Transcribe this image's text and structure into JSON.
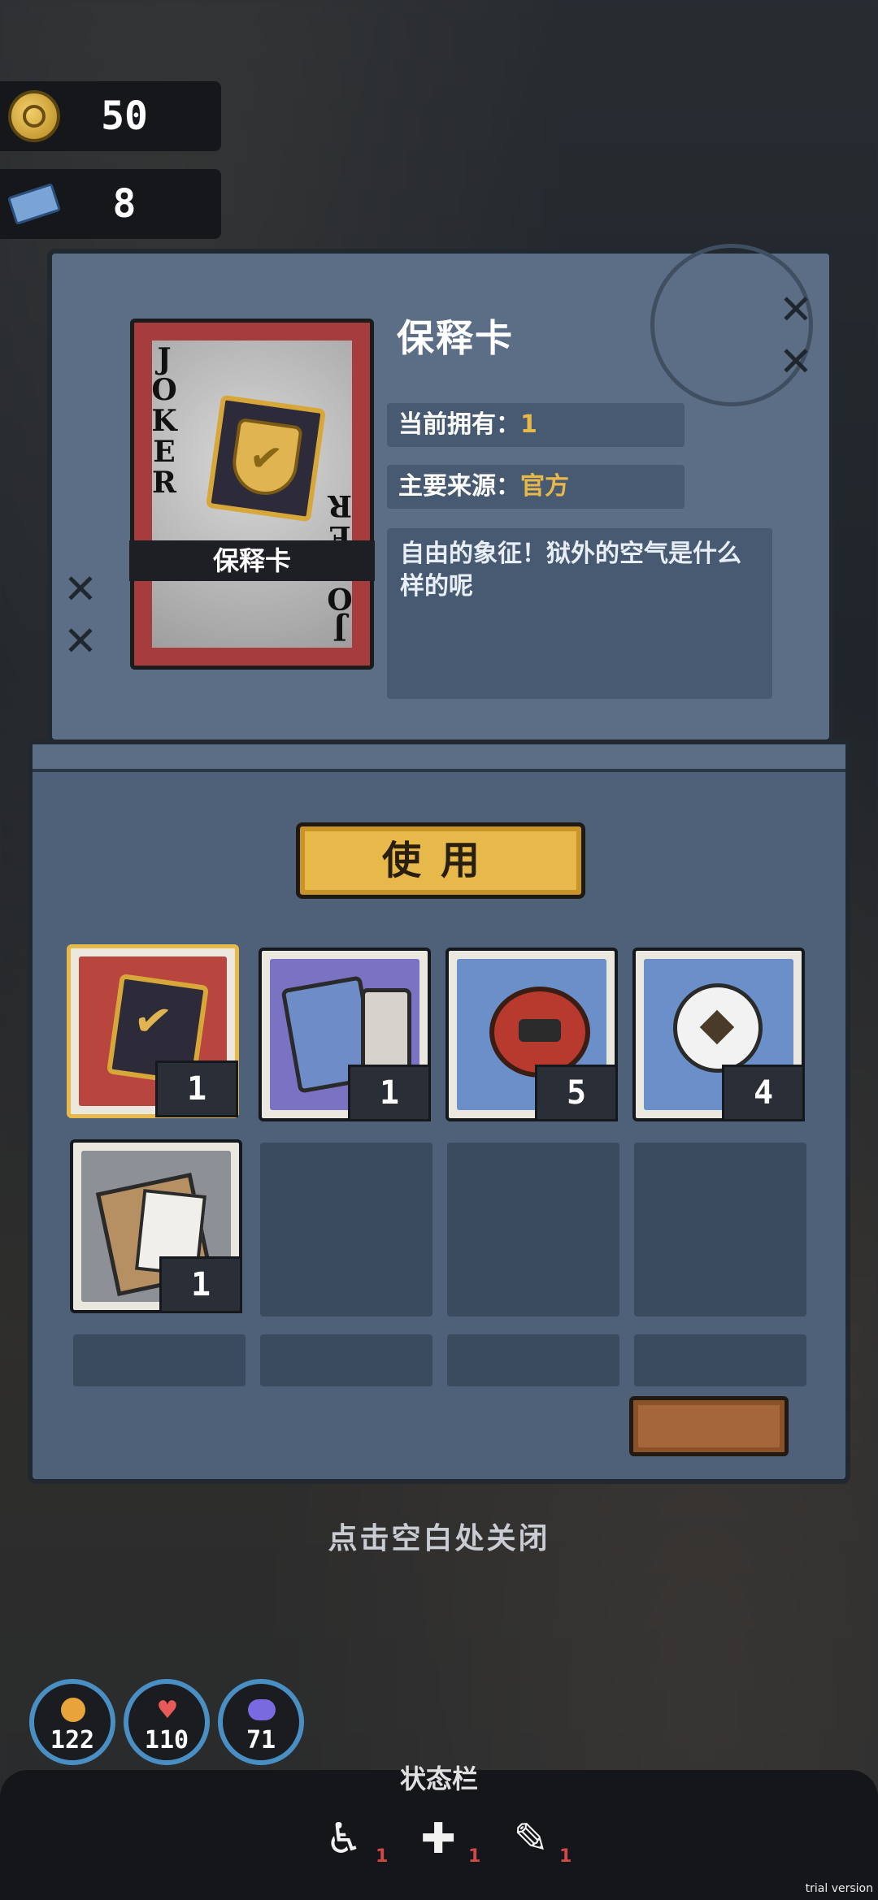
{
  "currency": {
    "coins": "50",
    "tickets": "8"
  },
  "item": {
    "title": "保释卡",
    "card_label": "保释卡",
    "card_corner_text": "JOKER",
    "owned_label": "当前拥有：",
    "owned_value": "1",
    "source_label": "主要来源：",
    "source_value": "官方",
    "description": "自由的象征！狱外的空气是什么样的呢"
  },
  "use_button": "使用",
  "inventory": [
    {
      "name": "bail-card",
      "icon": "shield-card-icon",
      "count": "1",
      "bg": "#b9453f",
      "selected": true
    },
    {
      "name": "map-pills",
      "icon": "map-pills-icon",
      "count": "1",
      "bg": "#7a72c2",
      "selected": false
    },
    {
      "name": "token",
      "icon": "token-icon",
      "count": "5",
      "bg": "#6a8fc9",
      "selected": false
    },
    {
      "name": "toilet-paper",
      "icon": "toilet-paper-icon",
      "count": "4",
      "bg": "#6a8fc9",
      "selected": false
    },
    {
      "name": "documents",
      "icon": "documents-icon",
      "count": "1",
      "bg": "#8e9097",
      "selected": false
    }
  ],
  "close_hint": "点击空白处关闭",
  "stats": [
    {
      "icon": "hunger-icon",
      "value": "122",
      "color": "#e8a43a"
    },
    {
      "icon": "heart-icon",
      "value": "110",
      "color": "#e85a5a"
    },
    {
      "icon": "brain-icon",
      "value": "71",
      "color": "#7a6ae0"
    }
  ],
  "status_bar": {
    "title": "状态栏",
    "items": [
      {
        "icon": "fatigue-icon",
        "count": "1"
      },
      {
        "icon": "bandage-icon",
        "count": "1"
      },
      {
        "icon": "injury-icon",
        "count": "1"
      }
    ]
  },
  "watermark": "trial version"
}
